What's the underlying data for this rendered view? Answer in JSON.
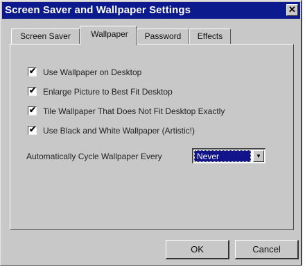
{
  "window": {
    "title": "Screen Saver and Wallpaper Settings",
    "close_glyph": "✕"
  },
  "tabs": [
    {
      "label": "Screen Saver",
      "active": false
    },
    {
      "label": "Wallpaper",
      "active": true
    },
    {
      "label": "Password",
      "active": false
    },
    {
      "label": "Effects",
      "active": false
    }
  ],
  "options": [
    {
      "label": "Use Wallpaper on Desktop",
      "checked": true
    },
    {
      "label": "Enlarge Picture to Best Fit Desktop",
      "checked": true
    },
    {
      "label": "Tile Wallpaper That Does Not Fit Desktop Exactly",
      "checked": true
    },
    {
      "label": "Use Black and White Wallpaper (Artistic!)",
      "checked": true
    }
  ],
  "cycle": {
    "label": "Automatically Cycle Wallpaper Every",
    "selected": "Never",
    "arrow_glyph": "▼"
  },
  "buttons": {
    "ok": "OK",
    "cancel": "Cancel"
  },
  "check_glyph": "✔"
}
